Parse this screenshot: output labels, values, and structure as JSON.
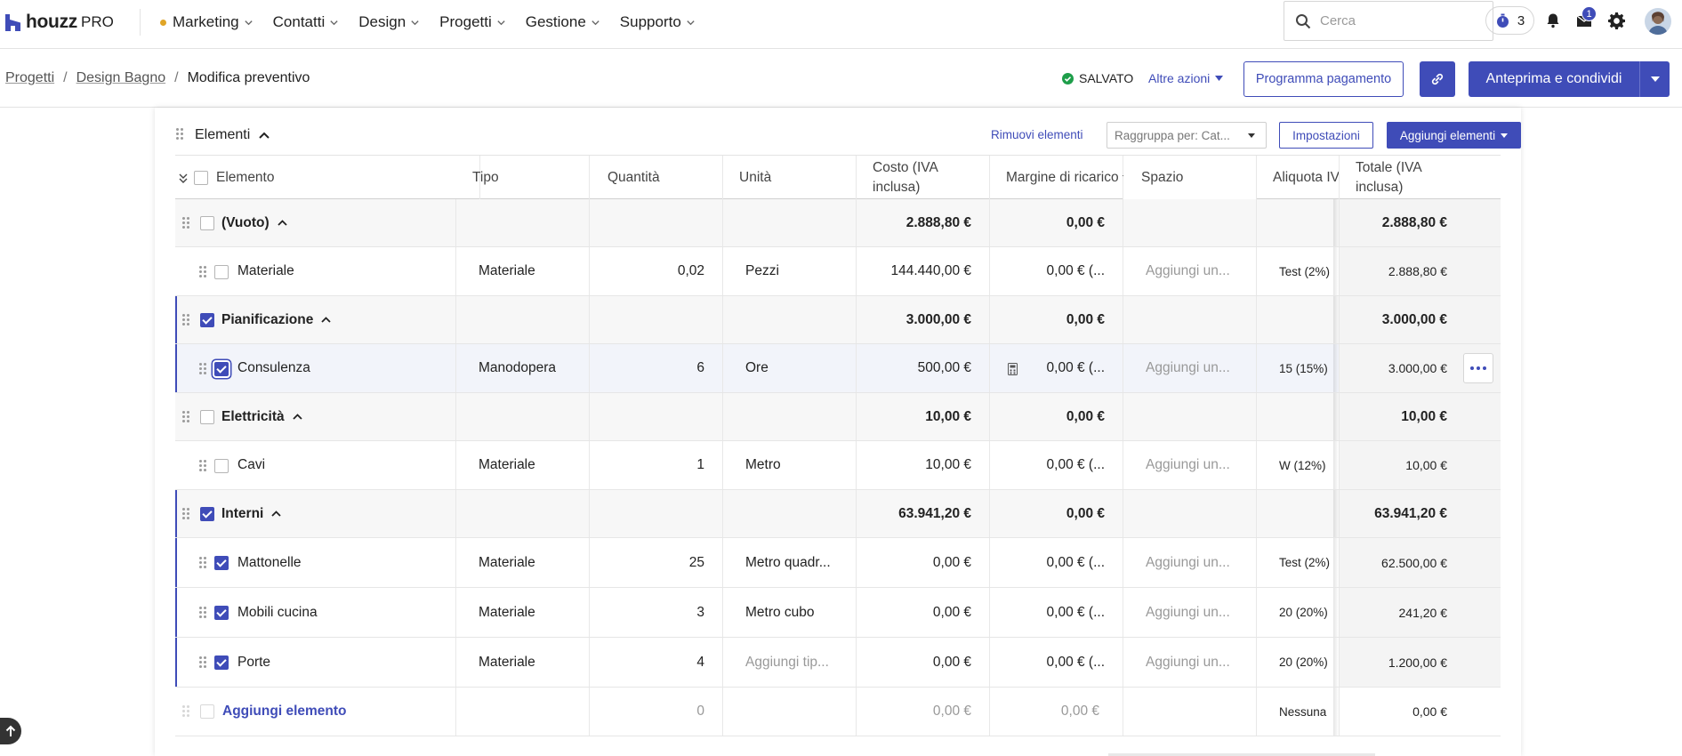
{
  "brand": {
    "logo_text": "houzz",
    "logo_suffix": "PRO"
  },
  "nav": {
    "items": [
      {
        "label": "Marketing",
        "dot": true
      },
      {
        "label": "Contatti"
      },
      {
        "label": "Design"
      },
      {
        "label": "Progetti"
      },
      {
        "label": "Gestione"
      },
      {
        "label": "Supporto"
      }
    ],
    "search_placeholder": "Cerca",
    "timer_count": "3",
    "inbox_badge": "1"
  },
  "subbar": {
    "breadcrumb": [
      "Progetti",
      "Design Bagno",
      "Modifica preventivo"
    ],
    "saved_label": "SALVATO",
    "more_actions_label": "Altre azioni",
    "payment_button": "Programma pagamento",
    "preview_button": "Anteprima e condividi"
  },
  "section": {
    "title": "Elementi",
    "remove_label": "Rimuovi elementi",
    "group_by_label": "Raggruppa per: Cat...",
    "settings_label": "Impostazioni",
    "add_items_label": "Aggiungi elementi"
  },
  "columns": {
    "elemento": "Elemento",
    "tipo": "Tipo",
    "quantita": "Quantità",
    "unita": "Unità",
    "costo": "Costo (IVA inclusa)",
    "margine": "Margine di ricarico",
    "spazio": "Spazio",
    "aliquota": "Aliquota IV",
    "totale": "Totale (IVA inclusa)"
  },
  "rows": [
    {
      "kind": "group",
      "name": "(Vuoto)",
      "checked": false,
      "costo": "2.888,80 €",
      "margine": "0,00 €",
      "totale": "2.888,80 €"
    },
    {
      "kind": "item",
      "name": "Materiale",
      "checked": false,
      "tipo": "Materiale",
      "quantita": "0,02",
      "unita": "Pezzi",
      "costo": "144.440,00 €",
      "margine": "0,00 € (...",
      "spazio": "Aggiungi un...",
      "aliquota": "Test (2%)",
      "totale": "2.888,80 €"
    },
    {
      "kind": "group",
      "name": "Pianificazione",
      "checked": true,
      "costo": "3.000,00 €",
      "margine": "0,00 €",
      "totale": "3.000,00 €"
    },
    {
      "kind": "item",
      "name": "Consulenza",
      "checked": true,
      "focus": true,
      "tipo": "Manodopera",
      "quantita": "6",
      "unita": "Ore",
      "costo": "500,00 €",
      "margine": "0,00 € (...",
      "spazio": "Aggiungi un...",
      "aliquota": "15 (15%)",
      "totale": "3.000,00 €"
    },
    {
      "kind": "group",
      "name": "Elettricità",
      "checked": false,
      "costo": "10,00 €",
      "margine": "0,00 €",
      "totale": "10,00 €"
    },
    {
      "kind": "item",
      "name": "Cavi",
      "checked": false,
      "tipo": "Materiale",
      "quantita": "1",
      "unita": "Metro",
      "costo": "10,00 €",
      "margine": "0,00 € (...",
      "spazio": "Aggiungi un...",
      "aliquota": "W (12%)",
      "totale": "10,00 €"
    },
    {
      "kind": "group",
      "name": "Interni",
      "checked": true,
      "costo": "63.941,20 €",
      "margine": "0,00 €",
      "totale": "63.941,20 €"
    },
    {
      "kind": "item",
      "name": "Mattonelle",
      "checked": true,
      "tipo": "Materiale",
      "quantita": "25",
      "unita": "Metro quadr...",
      "costo": "0,00 €",
      "margine": "0,00 € (...",
      "spazio": "Aggiungi un...",
      "aliquota": "Test (2%)",
      "totale": "62.500,00 €"
    },
    {
      "kind": "item",
      "name": "Mobili cucina",
      "checked": true,
      "tipo": "Materiale",
      "quantita": "3",
      "unita": "Metro cubo",
      "costo": "0,00 €",
      "margine": "0,00 € (...",
      "spazio": "Aggiungi un...",
      "aliquota": "20 (20%)",
      "totale": "241,20 €"
    },
    {
      "kind": "item",
      "name": "Porte",
      "checked": true,
      "tipo": "Materiale",
      "quantita": "4",
      "unita": "Aggiungi tip...",
      "unita_placeholder": true,
      "costo": "0,00 €",
      "margine": "0,00 € (...",
      "spazio": "Aggiungi un...",
      "aliquota": "20 (20%)",
      "totale": "1.200,00 €"
    }
  ],
  "add_row": {
    "label": "Aggiungi elemento",
    "quantita": "0",
    "costo": "0,00 €",
    "margine": "0,00 €",
    "aliquota": "Nessuna",
    "totale": "0,00 €"
  },
  "colors": {
    "accent": "#3f4cb8",
    "saved": "#1e9e4a",
    "marketing_dot": "#e0a526"
  }
}
